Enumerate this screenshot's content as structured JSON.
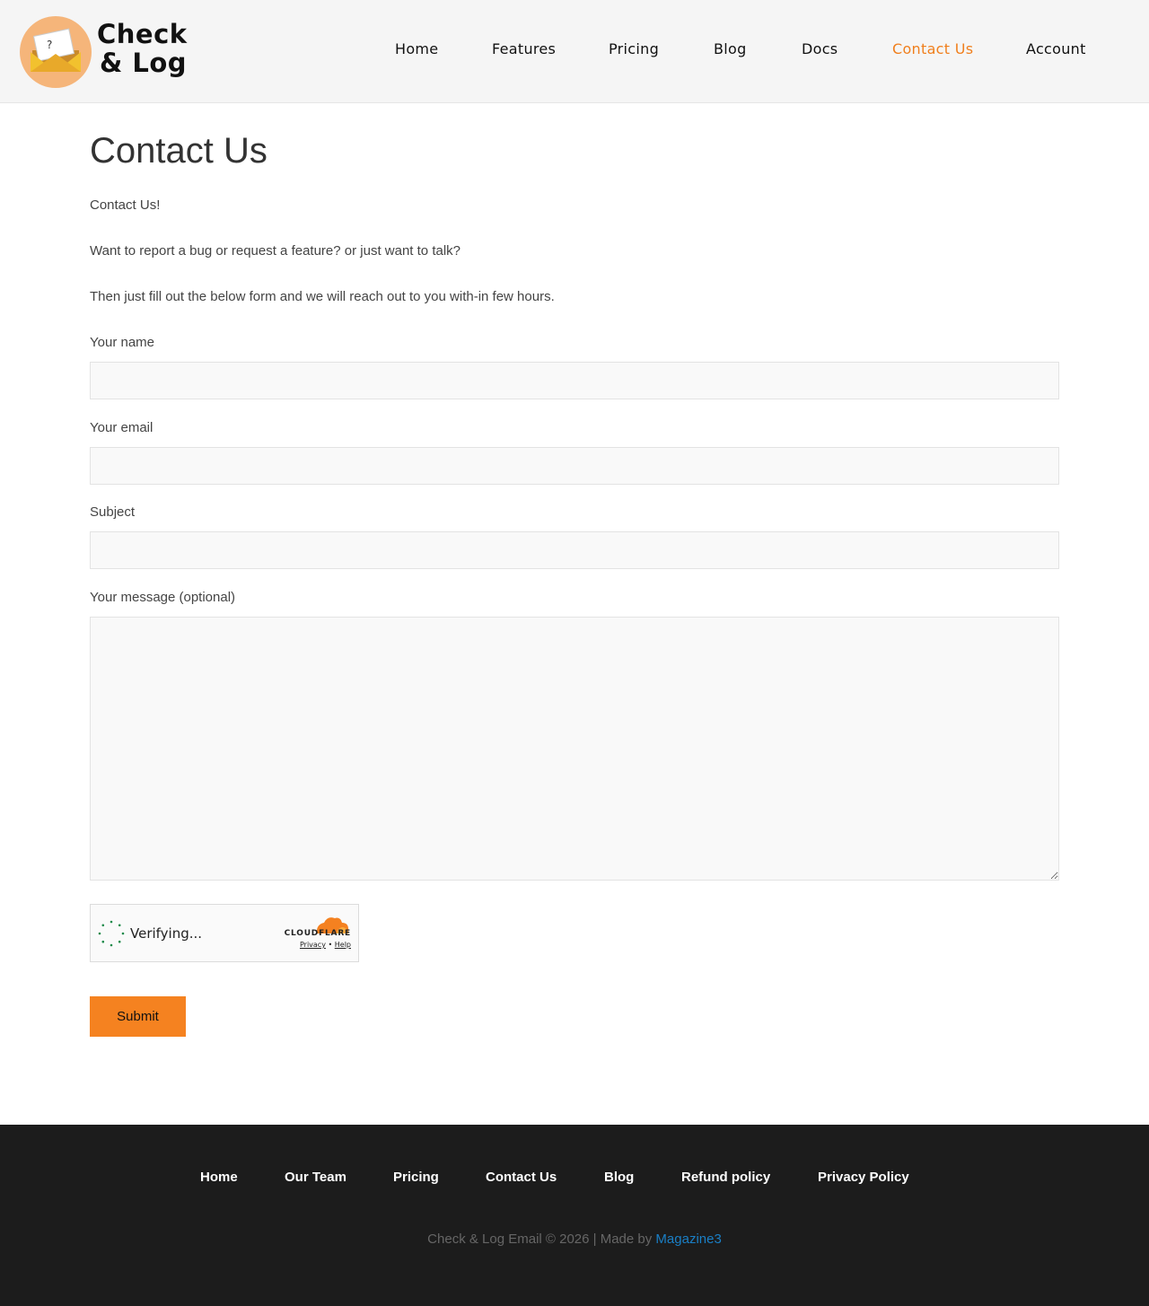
{
  "header": {
    "logo_line1": "Check",
    "logo_line2": "& Log",
    "nav": [
      {
        "label": "Home"
      },
      {
        "label": "Features"
      },
      {
        "label": "Pricing"
      },
      {
        "label": "Blog"
      },
      {
        "label": "Docs"
      },
      {
        "label": "Contact Us",
        "active": true
      },
      {
        "label": "Account"
      }
    ]
  },
  "main": {
    "title": "Contact Us",
    "intro": [
      "Contact Us!",
      "Want to report a bug or request a feature? or just want to talk?",
      "Then just fill out the below form and we will reach out to you with-in few hours."
    ],
    "form": {
      "name_label": "Your name",
      "name_value": "",
      "email_label": "Your email",
      "email_value": "",
      "subject_label": "Subject",
      "subject_value": "",
      "message_label": "Your message (optional)",
      "message_value": "",
      "submit_label": "Submit"
    },
    "captcha": {
      "status": "Verifying...",
      "brand": "CLOUDFLARE",
      "privacy": "Privacy",
      "separator": "•",
      "help": "Help"
    }
  },
  "footer": {
    "links": [
      {
        "label": "Home"
      },
      {
        "label": "Our Team"
      },
      {
        "label": "Pricing"
      },
      {
        "label": "Contact Us"
      },
      {
        "label": "Blog"
      },
      {
        "label": "Refund policy"
      },
      {
        "label": "Privacy Policy"
      }
    ],
    "copyright": "Check & Log Email  © 2026 | Made by",
    "made_by": "Magazine3"
  },
  "colors": {
    "accent": "#f58220",
    "nav_active": "#f07f1d",
    "footer_bg": "#1c1c1c",
    "link_blue": "#1a7fc6"
  }
}
